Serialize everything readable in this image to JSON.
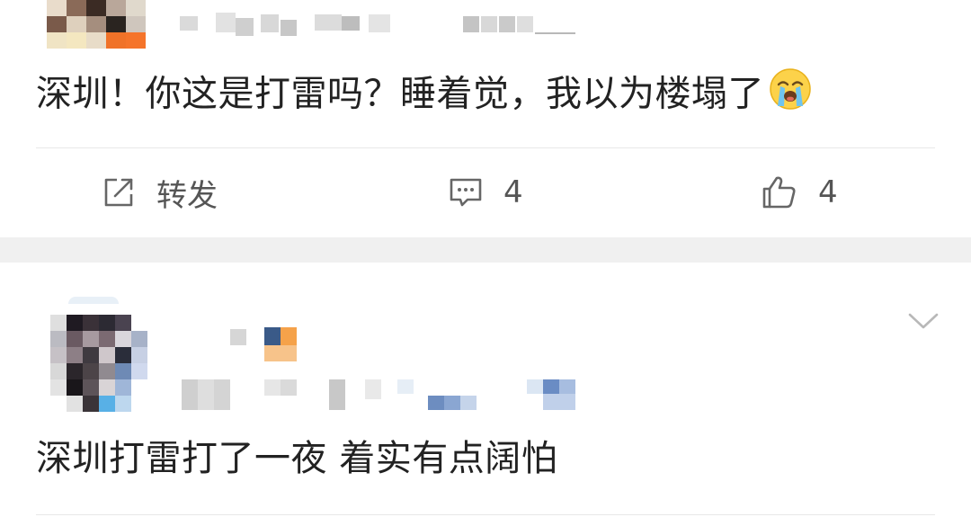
{
  "post": {
    "text": "深圳！你这是打雷吗？睡着觉，我以为楼塌了",
    "emoji_icon": "loudly-crying-face-icon"
  },
  "actions": {
    "repost": {
      "icon": "share-icon",
      "label": "转发"
    },
    "comment": {
      "icon": "comment-icon",
      "count": "4"
    },
    "like": {
      "icon": "thumbs-up-icon",
      "count": "4"
    }
  },
  "comment": {
    "text": "深圳打雷打了一夜 着实有点阔怕",
    "options_icon": "chevron-down-icon"
  },
  "colors": {
    "text": "#222222",
    "action_text": "#555555",
    "divider": "#e8e8e8",
    "section_gap": "#f0f0f0"
  }
}
